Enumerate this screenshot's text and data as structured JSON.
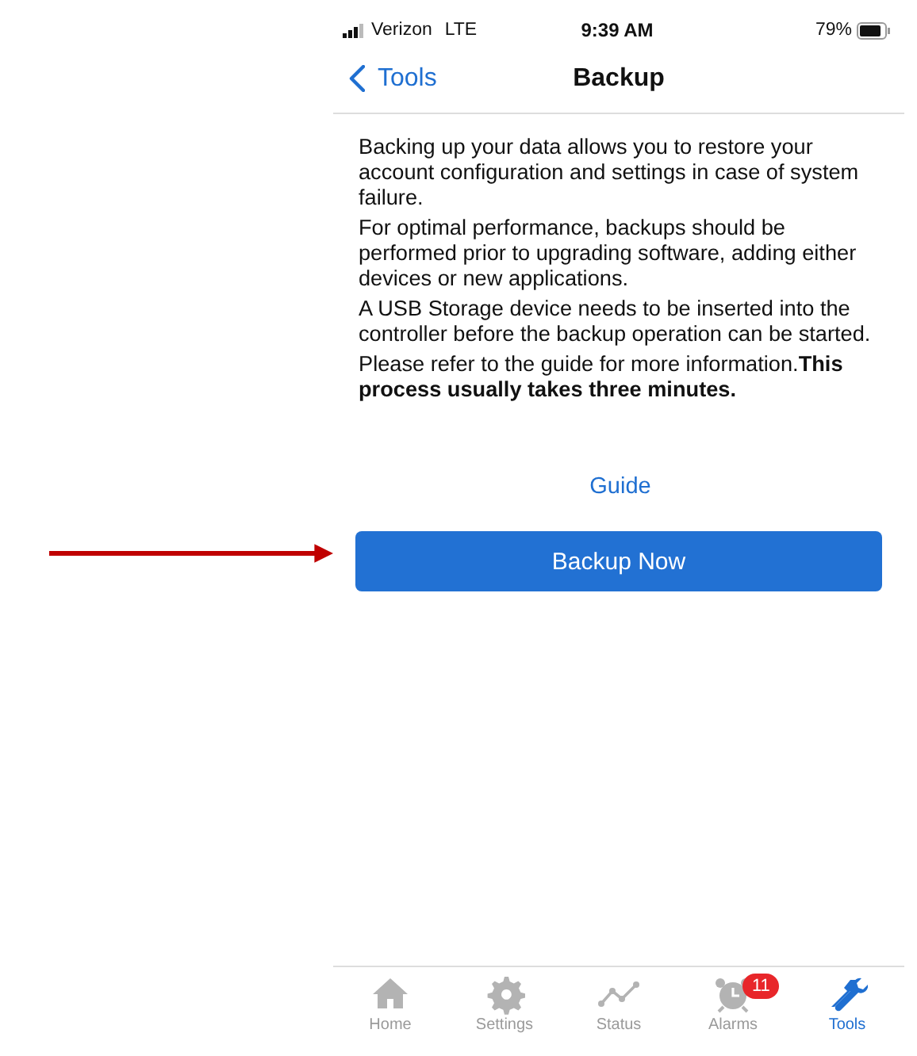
{
  "status_bar": {
    "carrier": "Verizon",
    "network": "LTE",
    "time": "9:39 AM",
    "battery": "79%"
  },
  "nav": {
    "back": "Tools",
    "title": "Backup"
  },
  "paragraphs": [
    "Backing up your data allows you to restore your account configuration and settings in case of system failure.",
    "For optimal performance, backups should be performed prior to upgrading software, adding either devices or new applications.",
    "A USB Storage device needs to be inserted into the controller before the backup operation can be started.",
    "Please refer to the guide for more information.**This process usually takes three minutes.**"
  ],
  "guide_link": "Guide",
  "primary_button": "Backup Now",
  "tabs": [
    {
      "label": "Home",
      "kind": "home",
      "selected": false
    },
    {
      "label": "Settings",
      "kind": "gear",
      "selected": false
    },
    {
      "label": "Status",
      "kind": "chart",
      "selected": false
    },
    {
      "label": "Alarms",
      "kind": "alarm",
      "selected": false,
      "badge": "11"
    },
    {
      "label": "Tools",
      "kind": "tools",
      "selected": true
    }
  ]
}
